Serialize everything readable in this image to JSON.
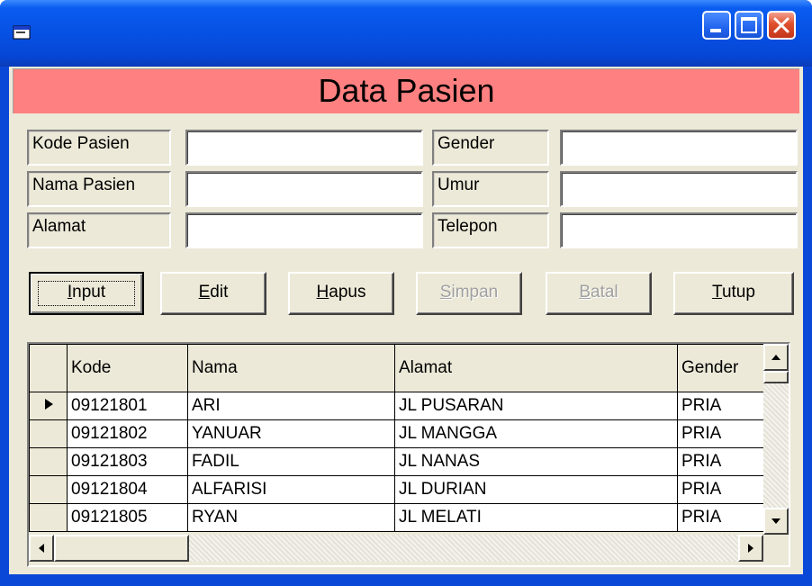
{
  "window": {
    "title": "",
    "close_color": "#e0502c",
    "titlebar_color": "#0651e4"
  },
  "banner": {
    "title": "Data Pasien",
    "color": "#ff8080"
  },
  "form": {
    "kode_label": "Kode Pasien",
    "nama_label": "Nama Pasien",
    "alamat_label": "Alamat",
    "gender_label": "Gender",
    "umur_label": "Umur",
    "telepon_label": "Telepon",
    "kode_value": "",
    "nama_value": "",
    "alamat_value": "",
    "gender_value": "",
    "umur_value": "",
    "telepon_value": ""
  },
  "buttons": {
    "input": {
      "hot": "I",
      "rest": "nput"
    },
    "edit": {
      "hot": "E",
      "rest": "dit"
    },
    "hapus": {
      "hot": "H",
      "rest": "apus"
    },
    "simpan": {
      "hot": "S",
      "rest": "impan"
    },
    "batal": {
      "hot": "B",
      "rest": "atal"
    },
    "tutup": {
      "hot": "T",
      "rest": "utup"
    }
  },
  "grid": {
    "columns": [
      "Kode",
      "Nama",
      "Alamat",
      "Gender"
    ],
    "rows": [
      [
        "09121801",
        "ARI",
        "JL PUSARAN",
        "PRIA"
      ],
      [
        "09121802",
        "YANUAR",
        "JL MANGGA",
        "PRIA"
      ],
      [
        "09121803",
        "FADIL",
        "JL NANAS",
        "PRIA"
      ],
      [
        "09121804",
        "ALFARISI",
        "JL DURIAN",
        "PRIA"
      ],
      [
        "09121805",
        "RYAN",
        "JL MELATI",
        "PRIA"
      ]
    ]
  }
}
